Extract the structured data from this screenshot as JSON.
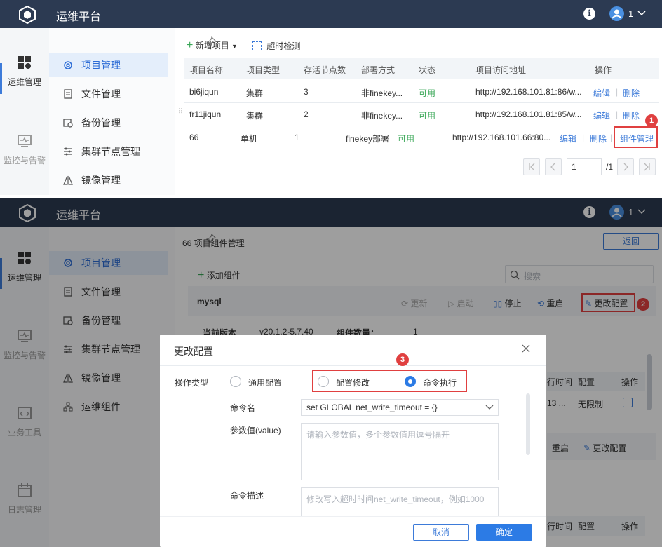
{
  "app": {
    "title": "运维平台",
    "user": "1"
  },
  "rail": [
    {
      "label": "运维管理",
      "icon": "grid-icon"
    },
    {
      "label": "监控与告警",
      "icon": "monitor-icon"
    },
    {
      "label": "业务工具",
      "icon": "code-icon"
    },
    {
      "label": "日志管理",
      "icon": "calendar-icon"
    }
  ],
  "menu": [
    {
      "label": "项目管理",
      "icon": "gear-icon"
    },
    {
      "label": "文件管理",
      "icon": "file-icon"
    },
    {
      "label": "备份管理",
      "icon": "backup-icon"
    },
    {
      "label": "集群节点管理",
      "icon": "sliders-icon"
    },
    {
      "label": "镜像管理",
      "icon": "mirror-icon"
    },
    {
      "label": "运维组件",
      "icon": "org-icon"
    }
  ],
  "toolbar": {
    "add": "新增项目",
    "timeout": "超时检测"
  },
  "table": {
    "headers": [
      "项目名称",
      "项目类型",
      "存活节点数",
      "部署方式",
      "状态",
      "项目访问地址",
      "操作"
    ],
    "rows": [
      [
        "bi6jiqun",
        "集群",
        "3",
        "非finekey...",
        "可用",
        "http://192.168.101.81:86/w..."
      ],
      [
        "fr11jiqun",
        "集群",
        "2",
        "非finekey...",
        "可用",
        "http://192.168.101.81:85/w..."
      ],
      [
        "66",
        "单机",
        "1",
        "finekey部署",
        "可用",
        "http://192.168.101.66:80..."
      ]
    ],
    "edit": "编辑",
    "delete": "删除",
    "component": "组件管理"
  },
  "pagination": {
    "page": "1",
    "total": "/1"
  },
  "component_page": {
    "title": "66 项目组件管理",
    "back": "返回",
    "add": "添加组件",
    "search_placeholder": "搜索",
    "component_name": "mysql",
    "actions": [
      "更新",
      "启动",
      "停止",
      "重启",
      "更改配置"
    ],
    "version_label": "当前版本",
    "version_value": "v20.1.2-5.7.40",
    "count_label": "组件数量：",
    "count_value": "1",
    "right_col1": "行时间",
    "right_col2": "配置",
    "right_col3": "操作",
    "right_val1": "13 ...",
    "right_val2": "无限制",
    "second_restart": "重启",
    "second_config": "更改配置",
    "bottom_col1": "行时间",
    "bottom_col2": "配置",
    "bottom_col3": "操作"
  },
  "dialog": {
    "title": "更改配置",
    "op_label": "操作类型",
    "options": [
      "通用配置",
      "配置修改",
      "命令执行"
    ],
    "cmd_label": "命令名",
    "cmd_value": "set GLOBAL net_write_timeout = {}",
    "param_label": "参数值(value)",
    "param_placeholder": "请输入参数值，多个参数值用逗号隔开",
    "desc_label": "命令描述",
    "desc_value": "修改写入超时时间net_write_timeout，例如1000",
    "cancel": "取消",
    "ok": "确定"
  },
  "badges": [
    "1",
    "2",
    "3"
  ],
  "colors": {
    "accent": "#3d7bd9",
    "header": "#2c3a52",
    "success": "#3aa757",
    "highlight": "#e04040"
  }
}
